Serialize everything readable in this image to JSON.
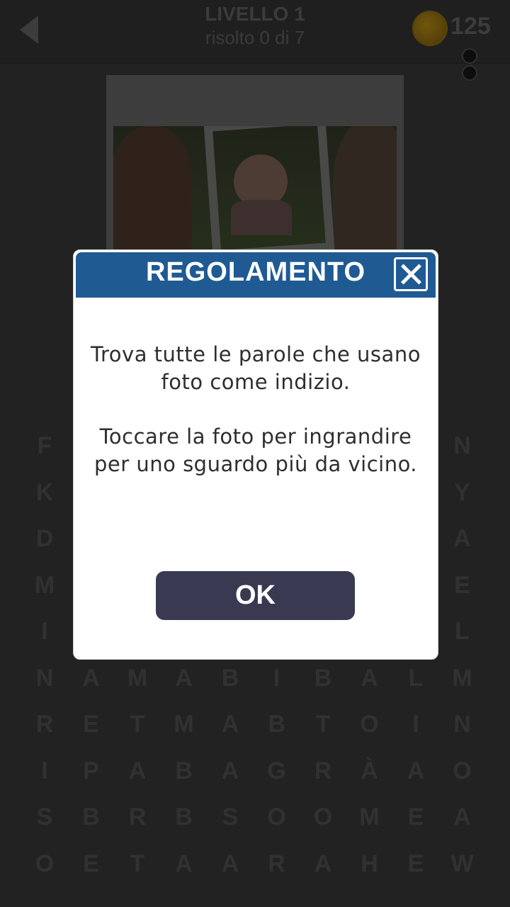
{
  "header": {
    "level_title": "LIVELLO 1",
    "level_progress": "risolto 0 di 7",
    "coins": "125",
    "icons": {
      "back": "back-arrow-icon",
      "coin": "coin-icon"
    }
  },
  "grid": {
    "rows": [
      [
        "F",
        "",
        "",
        "",
        "",
        "",
        "",
        "",
        "",
        "N"
      ],
      [
        "K",
        "",
        "",
        "",
        "",
        "",
        "",
        "",
        "",
        "Y"
      ],
      [
        "D",
        "",
        "",
        "",
        "",
        "",
        "",
        "",
        "",
        "A"
      ],
      [
        "M",
        "",
        "",
        "",
        "",
        "",
        "",
        "",
        "",
        "E"
      ],
      [
        "I",
        "",
        "",
        "",
        "",
        "",
        "",
        "",
        "",
        "L"
      ],
      [
        "N",
        "A",
        "M",
        "A",
        "B",
        "I",
        "B",
        "A",
        "L",
        "M"
      ],
      [
        "R",
        "E",
        "T",
        "M",
        "A",
        "B",
        "T",
        "O",
        "I",
        "N"
      ],
      [
        "I",
        "P",
        "A",
        "B",
        "A",
        "G",
        "R",
        "À",
        "A",
        "O"
      ],
      [
        "S",
        "B",
        "R",
        "B",
        "S",
        "O",
        "O",
        "M",
        "E",
        "A"
      ],
      [
        "O",
        "E",
        "T",
        "A",
        "A",
        "R",
        "A",
        "H",
        "E",
        "W"
      ]
    ]
  },
  "modal": {
    "title": "REGOLAMENTO",
    "line1": "Trova tutte le parole che usano foto come indizio.",
    "line2": "Toccare la foto per ingrandire per uno sguardo più da vicino.",
    "ok_label": "OK",
    "header_color": "#1f5a93",
    "button_color": "#393a52"
  }
}
